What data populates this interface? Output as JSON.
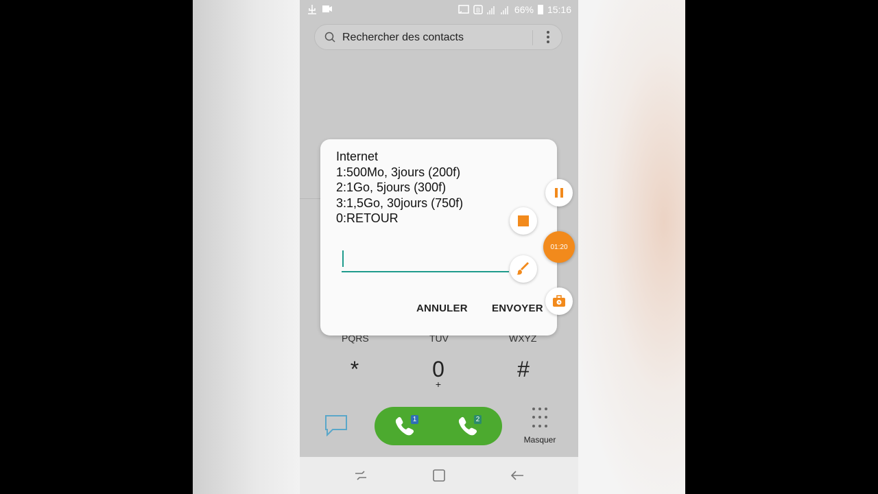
{
  "status_bar": {
    "battery": "66%",
    "time": "15:16"
  },
  "search": {
    "placeholder": "Rechercher des contacts"
  },
  "dialog": {
    "lines": [
      "Internet",
      "1:500Mo, 3jours (200f)",
      "2:1Go, 5jours (300f)",
      "3:1,5Go, 30jours (750f)",
      "0:RETOUR"
    ],
    "input_value": "",
    "cancel_label": "ANNULER",
    "send_label": "ENVOYER"
  },
  "recorder": {
    "timer": "01:20",
    "icons": [
      "pause-icon",
      "stop-icon",
      "brush-icon",
      "toolbox-icon"
    ],
    "accent": "#f28a1c"
  },
  "dialpad": {
    "letters": [
      "PQRS",
      "TUV",
      "WXYZ"
    ],
    "keys": [
      {
        "main": "*",
        "sub": ""
      },
      {
        "main": "0",
        "sub": "+"
      },
      {
        "main": "#",
        "sub": ""
      }
    ],
    "sim_badges": [
      "1",
      "2"
    ],
    "toggle_label": "Masquer"
  },
  "colors": {
    "call_green": "#4caa2f",
    "input_underline": "#1e9b8c",
    "message_icon": "#5aa7c9"
  }
}
